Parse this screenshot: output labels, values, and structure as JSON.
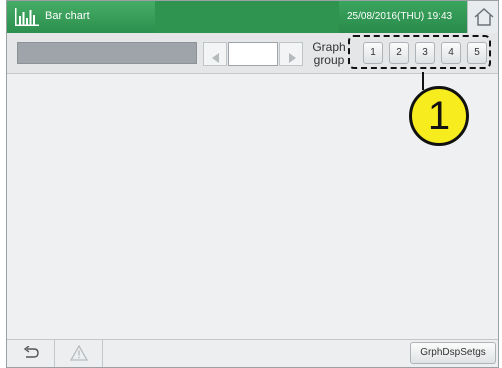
{
  "titlebar": {
    "title": "Bar chart",
    "datetime": "25/08/2016(THU) 19:43"
  },
  "toolbar": {
    "graph_group_label_line1": "Graph",
    "graph_group_label_line2": "group",
    "group_buttons": [
      "1",
      "2",
      "3",
      "4",
      "5"
    ]
  },
  "callout": {
    "number": "1"
  },
  "bottombar": {
    "settings_label": "GrphDspSetgs"
  },
  "icons": {
    "app": "bar-chart-icon",
    "home": "home-icon",
    "back": "return-icon",
    "warning": "warning-icon",
    "prev": "triangle-left-icon",
    "next": "triangle-right-icon"
  },
  "colors": {
    "titlebar": "#2f9a55",
    "callout": "#f6ec1e"
  }
}
